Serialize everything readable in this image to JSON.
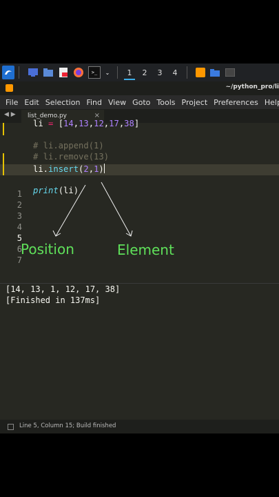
{
  "taskbar": {
    "workspaces": [
      "1",
      "2",
      "3",
      "4"
    ],
    "active_workspace": "1",
    "terminal_glyph": ">_"
  },
  "window": {
    "path": "~/python_pro/li"
  },
  "menu": [
    "File",
    "Edit",
    "Selection",
    "Find",
    "View",
    "Goto",
    "Tools",
    "Project",
    "Preferences",
    "Help"
  ],
  "tab": {
    "filename": "list_demo.py",
    "close": "×",
    "arrows": "◀ ▶"
  },
  "editor": {
    "line_numbers": [
      "1",
      "2",
      "3",
      "4",
      "5",
      "6",
      "7"
    ],
    "current_line": "5",
    "lines": {
      "l1": {
        "var": "li",
        "eq": " = ",
        "open": "[",
        "n1": "14",
        "n2": "13",
        "n3": "12",
        "n4": "17",
        "n5": "38",
        "close": "]"
      },
      "l3": "# li.append(1)",
      "l4": "# li.remove(13)",
      "l5": {
        "obj": "li.",
        "fn": "insert",
        "open": "(",
        "a1": "2",
        "comma": ",",
        "a2": "1",
        "close": ")"
      },
      "l7": {
        "fn": "print",
        "args": "(li)"
      }
    }
  },
  "annotations": {
    "position": "Position",
    "element": "Element"
  },
  "output": {
    "result": "[14, 13, 1, 12, 17, 38]",
    "finished": "[Finished in 137ms]"
  },
  "status": "Line 5, Column 15; Build finished",
  "colors": {
    "background": "#272822",
    "annotation": "#5fe05a",
    "number": "#ae81ff",
    "comment": "#75715e",
    "function": "#66d9ef"
  }
}
